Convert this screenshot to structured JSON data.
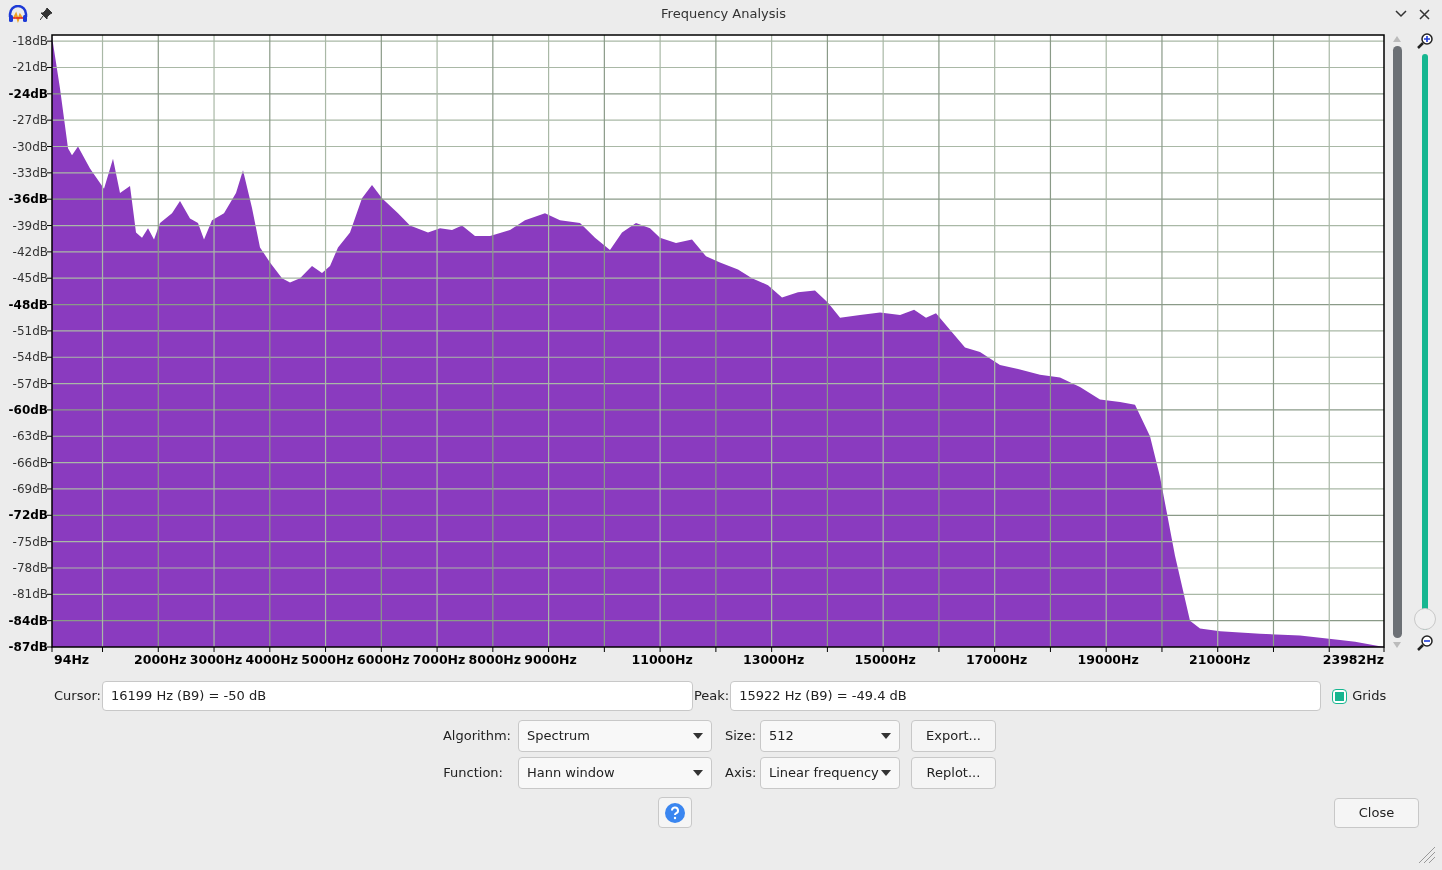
{
  "window": {
    "title": "Frequency Analysis"
  },
  "chart": {
    "chart_data": {
      "type": "area",
      "grid": true,
      "xlim": [
        94,
        23982
      ],
      "ylim": [
        -87,
        -17.3
      ],
      "x": [
        94,
        94,
        237,
        381,
        453,
        560,
        775,
        1027,
        1188,
        1314,
        1493,
        1600,
        1708,
        1816,
        1923,
        2031,
        2246,
        2390,
        2569,
        2712,
        2820,
        2963,
        3179,
        3394,
        3519,
        3681,
        3824,
        4003,
        4219,
        4362,
        4541,
        4757,
        4936,
        5080,
        5223,
        5438,
        5653,
        5833,
        6012,
        6299,
        6514,
        6837,
        7052,
        7268,
        7447,
        7680,
        7949,
        8308,
        8577,
        8936,
        9205,
        9564,
        9833,
        10101,
        10317,
        10568,
        10819,
        10998,
        11285,
        11572,
        11823,
        12074,
        12397,
        12648,
        12935,
        13186,
        13473,
        13778,
        14011,
        14227,
        14585,
        14944,
        15303,
        15554,
        15769,
        15948,
        16163,
        16468,
        16737,
        17096,
        17454,
        17813,
        18172,
        18530,
        18889,
        19248,
        19517,
        19786,
        19965,
        20234,
        20503,
        20683,
        21042,
        21759,
        22476,
        23194,
        23463,
        23982
      ],
      "series": [
        {
          "color": "#8a3bbf",
          "values": [
            -87,
            -17.5,
            -23.4,
            -30.2,
            -31,
            -30,
            -32.5,
            -34.8,
            -31.4,
            -35.3,
            -34.5,
            -39.8,
            -40.4,
            -39.3,
            -40.6,
            -38.7,
            -37.6,
            -36.2,
            -38.2,
            -38.7,
            -40.6,
            -38.4,
            -37.6,
            -35.3,
            -32.7,
            -37,
            -41.5,
            -43.2,
            -45,
            -45.5,
            -45,
            -43.6,
            -44.4,
            -43.6,
            -41.5,
            -39.8,
            -35.9,
            -34.4,
            -35.9,
            -37.6,
            -39,
            -39.8,
            -39.3,
            -39.5,
            -39,
            -40.2,
            -40.2,
            -39.5,
            -38.4,
            -37.6,
            -38.4,
            -38.7,
            -40.4,
            -41.8,
            -39.8,
            -38.7,
            -39.3,
            -40.4,
            -41,
            -40.6,
            -42.5,
            -43.2,
            -44,
            -45,
            -45.8,
            -47.2,
            -46.6,
            -46.4,
            -47.8,
            -49.5,
            -49.2,
            -48.9,
            -49.2,
            -48.6,
            -49.5,
            -49,
            -50.6,
            -52.9,
            -53.4,
            -54.9,
            -55.4,
            -56,
            -56.3,
            -57.4,
            -58.8,
            -59.1,
            -59.4,
            -63,
            -67.6,
            -76.6,
            -84,
            -84.9,
            -85.2,
            -85.5,
            -85.7,
            -86.2,
            -86.4,
            -87
          ]
        }
      ],
      "xticks": [
        {
          "value": 94,
          "label": "94Hz"
        },
        {
          "value": 2000,
          "label": "2000Hz"
        },
        {
          "value": 3000,
          "label": "3000Hz"
        },
        {
          "value": 4000,
          "label": "4000Hz"
        },
        {
          "value": 5000,
          "label": "5000Hz"
        },
        {
          "value": 6000,
          "label": "6000Hz"
        },
        {
          "value": 7000,
          "label": "7000Hz"
        },
        {
          "value": 8000,
          "label": "8000Hz"
        },
        {
          "value": 9000,
          "label": "9000Hz"
        },
        {
          "value": 11000,
          "label": "11000Hz"
        },
        {
          "value": 13000,
          "label": "13000Hz"
        },
        {
          "value": 15000,
          "label": "15000Hz"
        },
        {
          "value": 17000,
          "label": "17000Hz"
        },
        {
          "value": 19000,
          "label": "19000Hz"
        },
        {
          "value": 21000,
          "label": "21000Hz"
        },
        {
          "value": 23982,
          "label": "23982Hz"
        }
      ],
      "yticks": [
        {
          "value": -18,
          "label": "-18dB"
        },
        {
          "value": -21,
          "label": "-21dB"
        },
        {
          "value": -24,
          "label": "-24dB"
        },
        {
          "value": -27,
          "label": "-27dB"
        },
        {
          "value": -30,
          "label": "-30dB"
        },
        {
          "value": -33,
          "label": "-33dB"
        },
        {
          "value": -36,
          "label": "-36dB"
        },
        {
          "value": -39,
          "label": "-39dB"
        },
        {
          "value": -42,
          "label": "-42dB"
        },
        {
          "value": -45,
          "label": "-45dB"
        },
        {
          "value": -48,
          "label": "-48dB"
        },
        {
          "value": -51,
          "label": "-51dB"
        },
        {
          "value": -54,
          "label": "-54dB"
        },
        {
          "value": -57,
          "label": "-57dB"
        },
        {
          "value": -60,
          "label": "-60dB"
        },
        {
          "value": -63,
          "label": "-63dB"
        },
        {
          "value": -66,
          "label": "-66dB"
        },
        {
          "value": -69,
          "label": "-69dB"
        },
        {
          "value": -72,
          "label": "-72dB"
        },
        {
          "value": -75,
          "label": "-75dB"
        },
        {
          "value": -78,
          "label": "-78dB"
        },
        {
          "value": -81,
          "label": "-81dB"
        },
        {
          "value": -84,
          "label": "-84dB"
        },
        {
          "value": -87,
          "label": "-87dB"
        }
      ]
    }
  },
  "zoom_slider": {
    "level": 0
  },
  "cursor": {
    "label": "Cursor:",
    "value": "16199 Hz (B9) = -50 dB"
  },
  "peak": {
    "label": "Peak:",
    "value": "15922 Hz (B9) = -49.4 dB"
  },
  "grids": {
    "label": "Grids",
    "checked": true
  },
  "algorithm": {
    "label": "Algorithm:",
    "value": "Spectrum"
  },
  "size": {
    "label": "Size:",
    "value": "512"
  },
  "export_button": "Export...",
  "function": {
    "label": "Function:",
    "value": "Hann window"
  },
  "axis": {
    "label": "Axis:",
    "value": "Linear frequency"
  },
  "replot_button": "Replot...",
  "close_button": "Close"
}
